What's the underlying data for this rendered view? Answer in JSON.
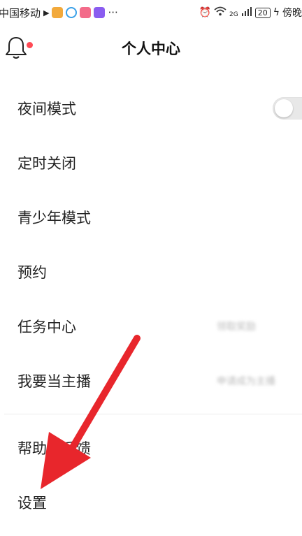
{
  "status_bar": {
    "carrier": "中国移动",
    "more": "···",
    "network": "2G",
    "battery": "20",
    "right_text": "傍晚"
  },
  "header": {
    "title": "个人中心"
  },
  "menu": {
    "items": [
      {
        "label": "夜间模式",
        "control": "toggle",
        "toggle_on": false
      },
      {
        "label": "定时关闭"
      },
      {
        "label": "青少年模式"
      },
      {
        "label": "预约"
      },
      {
        "label": "任务中心",
        "hint": "领取奖励"
      },
      {
        "label": "我要当主播",
        "hint": "申请成为主播"
      },
      {
        "label": "帮助与反馈"
      },
      {
        "label": "设置"
      }
    ]
  },
  "colors": {
    "notification_dot": "#ff4a55",
    "arrow": "#e8262c"
  }
}
